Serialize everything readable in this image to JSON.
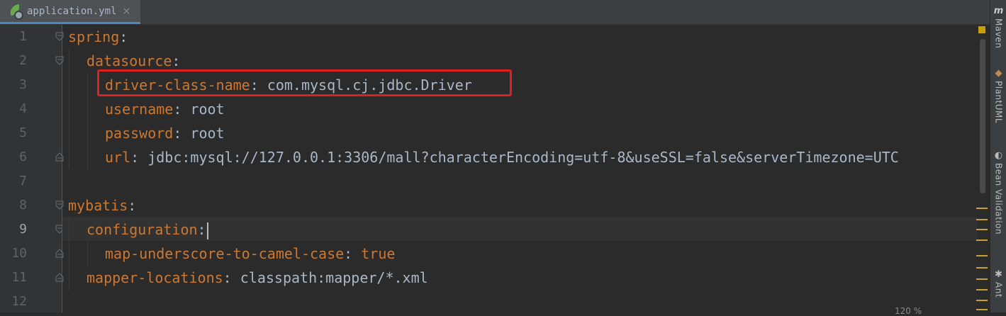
{
  "tab": {
    "title": "application.yml",
    "close": "×",
    "icon": "spring-yaml-file-icon"
  },
  "lines": [
    {
      "n": "1",
      "key": "spring",
      "sep": ":"
    },
    {
      "n": "2",
      "key": "datasource",
      "sep": ":"
    },
    {
      "n": "3",
      "key": "driver-class-name",
      "sep": ": ",
      "value": "com.mysql.cj.jdbc.Driver"
    },
    {
      "n": "4",
      "key": "username",
      "sep": ": ",
      "value": "root"
    },
    {
      "n": "5",
      "key": "password",
      "sep": ": ",
      "value": "root"
    },
    {
      "n": "6",
      "key": "url",
      "sep": ": ",
      "value": "jdbc:mysql://127.0.0.1:3306/mall?characterEncoding=utf-8&useSSL=false&serverTimezone=UTC"
    },
    {
      "n": "7"
    },
    {
      "n": "8",
      "key": "mybatis",
      "sep": ":"
    },
    {
      "n": "9",
      "key": "configuration",
      "sep": ":"
    },
    {
      "n": "10",
      "key": "map-underscore-to-camel-case",
      "sep": ": ",
      "value": "true"
    },
    {
      "n": "11",
      "key": "mapper-locations",
      "sep": ": ",
      "value": "classpath:mapper/*.xml"
    },
    {
      "n": "12"
    }
  ],
  "current_line": "9",
  "zoom_label": "120 %",
  "tool_windows": [
    {
      "label": "Maven",
      "icon": "maven-icon",
      "glyph": "m"
    },
    {
      "label": "PlantUML",
      "icon": "plantuml-icon",
      "glyph": "◆"
    },
    {
      "label": "Bean Validation",
      "icon": "bean-validation-icon",
      "glyph": "◐"
    },
    {
      "label": "Ant",
      "icon": "ant-icon",
      "glyph": "✱"
    }
  ],
  "colors": {
    "background": "#2b2b2b",
    "key": "#cc7832",
    "value": "#a9b7c6",
    "highlight_box": "#e02020",
    "tab_underline": "#4a88c7"
  }
}
